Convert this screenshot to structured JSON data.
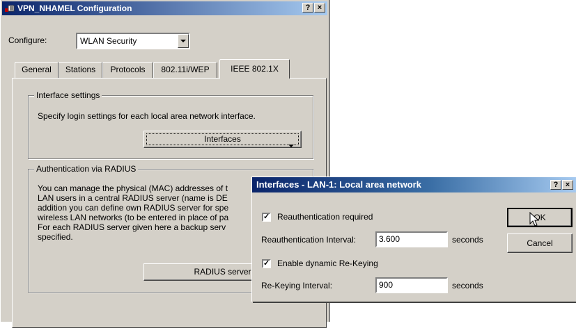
{
  "main_window": {
    "title": "VPN_NHAMEL Configuration",
    "help_button": "?",
    "close_button": "×",
    "configure_label": "Configure:",
    "configure_value": "WLAN Security",
    "tabs": [
      {
        "label": "General"
      },
      {
        "label": "Stations"
      },
      {
        "label": "Protocols"
      },
      {
        "label": "802.11i/WEP"
      },
      {
        "label": "IEEE 802.1X",
        "active": true
      }
    ],
    "interface_settings": {
      "title": "Interface settings",
      "text": "Specify login settings for each local area network interface.",
      "button": "Interfaces"
    },
    "radius": {
      "title": "Authentication via RADIUS",
      "lines": [
        "You can manage the physical (MAC) addresses of t",
        "LAN users in a central RADIUS server (name is DE",
        "addition you can define own RADIUS server for spe",
        "wireless LAN networks (to be entered in place of pa",
        "For each RADIUS server given here a backup serv",
        "specified."
      ],
      "button": "RADIUS server"
    }
  },
  "dialog": {
    "title": "Interfaces - LAN-1: Local area network",
    "help_button": "?",
    "close_button": "×",
    "reauth_required_label": "Reauthentication required",
    "reauth_required_checked": true,
    "reauth_interval_label": "Reauthentication Interval:",
    "reauth_interval_value": "3.600",
    "reauth_interval_unit": "seconds",
    "dynamic_rekeying_label": "Enable dynamic Re-Keying",
    "dynamic_rekeying_checked": true,
    "rekeying_interval_label": "Re-Keying Interval:",
    "rekeying_interval_value": "900",
    "rekeying_interval_unit": "seconds",
    "ok_button": "OK",
    "cancel_button": "Cancel"
  },
  "colors": {
    "title_active_start": "#0a246a",
    "title_active_end": "#a6caf0",
    "face": "#d4d0c8"
  }
}
